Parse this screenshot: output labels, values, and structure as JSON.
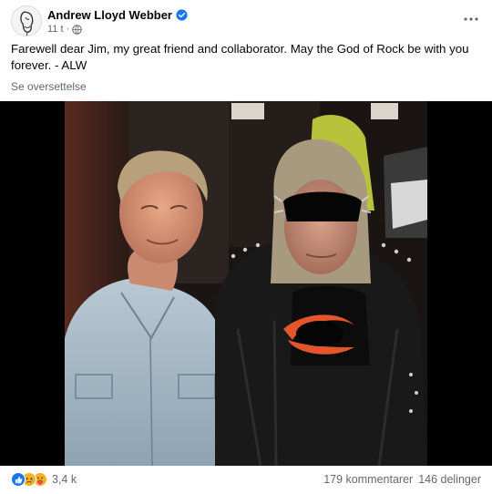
{
  "post": {
    "author": "Andrew Lloyd Webber",
    "time": "11 t",
    "separator": "·",
    "text": "Farewell dear Jim, my great friend and collaborator. May the God of Rock be with you forever. - ALW",
    "translate_link": "Se oversettelse",
    "image_alt": "Andrew Lloyd Webber and Jim Steinman"
  },
  "footer": {
    "reaction_icons": [
      "like-icon",
      "sad-icon",
      "care-icon"
    ],
    "reaction_count": "3,4 k",
    "comments": "179 kommentarer",
    "shares": "146 delinger"
  },
  "colors": {
    "accent": "#1877f2",
    "secondary_text": "#65676b",
    "reaction_yellow": "#f7b125"
  }
}
